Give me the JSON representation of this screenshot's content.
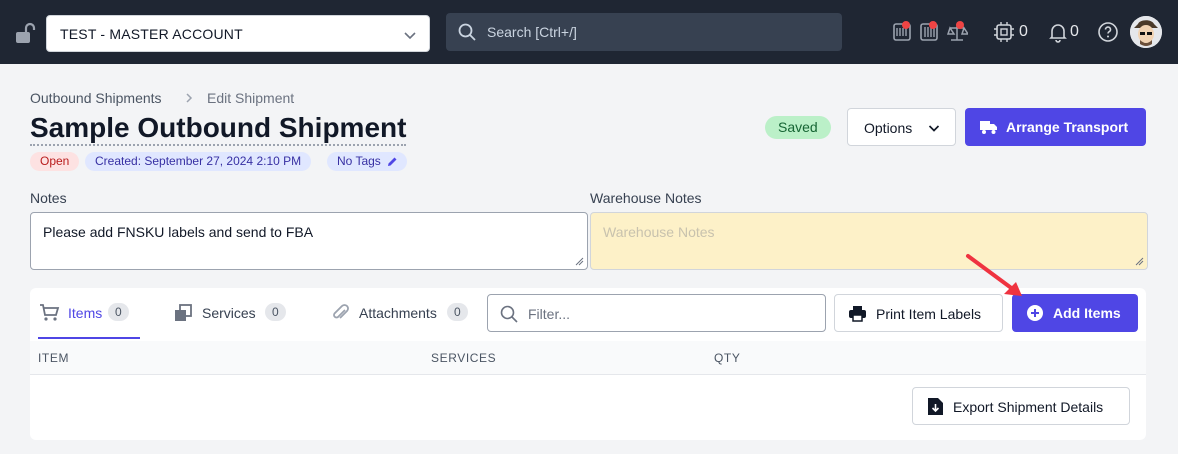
{
  "topbar": {
    "account": "TEST - MASTER ACCOUNT",
    "search_placeholder": "Search [Ctrl+/]",
    "chip_count": "0",
    "bell_count": "0"
  },
  "breadcrumb": {
    "parent": "Outbound Shipments",
    "current": "Edit Shipment"
  },
  "page": {
    "title": "Sample Outbound Shipment",
    "status": "Open",
    "created": "Created: September 27, 2024 2:10 PM",
    "tags": "No Tags",
    "saved": "Saved",
    "options_label": "Options",
    "arrange_label": "Arrange Transport"
  },
  "notes": {
    "label": "Notes",
    "value": "Please add FNSKU labels and send to FBA",
    "warehouse_label": "Warehouse Notes",
    "warehouse_placeholder": "Warehouse Notes"
  },
  "tabs": [
    {
      "label": "Items",
      "count": "0"
    },
    {
      "label": "Services",
      "count": "0"
    },
    {
      "label": "Attachments",
      "count": "0"
    }
  ],
  "toolbar": {
    "filter_placeholder": "Filter...",
    "print_label": "Print Item Labels",
    "add_label": "Add Items"
  },
  "table": {
    "columns": [
      "ITEM",
      "SERVICES",
      "QTY"
    ]
  },
  "export_label": "Export Shipment Details",
  "colors": {
    "topbar": "#1f2633",
    "accent": "#4f46e5",
    "warehouse_bg": "#fdf1c8",
    "arrow": "#ef3340"
  }
}
